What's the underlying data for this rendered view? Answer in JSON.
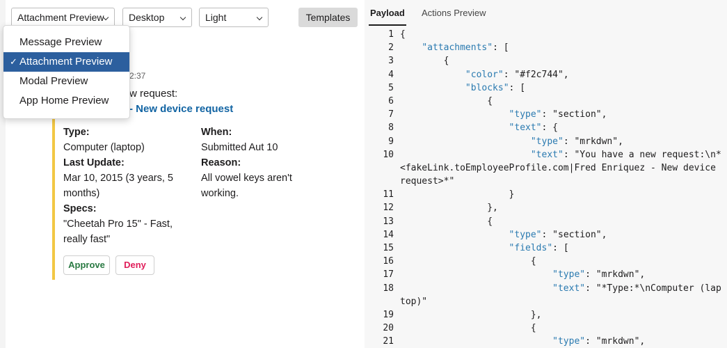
{
  "toolbar": {
    "view_select": "Attachment Preview",
    "device_select": "Desktop",
    "theme_select": "Light",
    "templates_label": "Templates"
  },
  "menu": {
    "items": [
      {
        "label": "Message Preview",
        "selected": false
      },
      {
        "label": "Attachment Preview",
        "selected": true
      },
      {
        "label": "Modal Preview",
        "selected": false
      },
      {
        "label": "App Home Preview",
        "selected": false
      }
    ],
    "check": "✓"
  },
  "message": {
    "time": "2:37",
    "text": "w request:",
    "link": "- New device request"
  },
  "attachment": {
    "color": "#f2c744",
    "fields": [
      {
        "title": "Type:",
        "value": "Computer (laptop)"
      },
      {
        "title": "When:",
        "value": "Submitted Aut 10"
      },
      {
        "title": "Last Update:",
        "value": "Mar 10, 2015 (3 years, 5 months)"
      },
      {
        "title": "Reason:",
        "value": "All vowel keys aren't working."
      },
      {
        "title": "Specs:",
        "value": "\"Cheetah Pro 15\" - Fast, really fast\""
      }
    ],
    "approve_label": "Approve",
    "deny_label": "Deny"
  },
  "tabs": {
    "payload": "Payload",
    "actions": "Actions Preview"
  },
  "code": {
    "lines": [
      {
        "n": "1",
        "pre": "{",
        "key": "",
        "post": ""
      },
      {
        "n": "2",
        "pre": "    ",
        "key": "\"attachments\"",
        "post": ": ["
      },
      {
        "n": "3",
        "pre": "        {",
        "key": "",
        "post": ""
      },
      {
        "n": "4",
        "pre": "            ",
        "key": "\"color\"",
        "post": ": \"#f2c744\","
      },
      {
        "n": "5",
        "pre": "            ",
        "key": "\"blocks\"",
        "post": ": ["
      },
      {
        "n": "6",
        "pre": "                {",
        "key": "",
        "post": ""
      },
      {
        "n": "7",
        "pre": "                    ",
        "key": "\"type\"",
        "post": ": \"section\","
      },
      {
        "n": "8",
        "pre": "                    ",
        "key": "\"text\"",
        "post": ": {"
      },
      {
        "n": "9",
        "pre": "                        ",
        "key": "\"type\"",
        "post": ": \"mrkdwn\","
      },
      {
        "n": "10",
        "pre": "                        ",
        "key": "\"text\"",
        "post": ": \"You have a new request:\\n*<fakeLink.toEmployeeProfile.com|Fred Enriquez - New device request>*\""
      },
      {
        "n": "11",
        "pre": "                    }",
        "key": "",
        "post": ""
      },
      {
        "n": "12",
        "pre": "                },",
        "key": "",
        "post": ""
      },
      {
        "n": "13",
        "pre": "                {",
        "key": "",
        "post": ""
      },
      {
        "n": "14",
        "pre": "                    ",
        "key": "\"type\"",
        "post": ": \"section\","
      },
      {
        "n": "15",
        "pre": "                    ",
        "key": "\"fields\"",
        "post": ": ["
      },
      {
        "n": "16",
        "pre": "                        {",
        "key": "",
        "post": ""
      },
      {
        "n": "17",
        "pre": "                            ",
        "key": "\"type\"",
        "post": ": \"mrkdwn\","
      },
      {
        "n": "18",
        "pre": "                            ",
        "key": "\"text\"",
        "post": ": \"*Type:*\\nComputer (laptop)\""
      },
      {
        "n": "19",
        "pre": "                        },",
        "key": "",
        "post": ""
      },
      {
        "n": "20",
        "pre": "                        {",
        "key": "",
        "post": ""
      },
      {
        "n": "21",
        "pre": "                            ",
        "key": "\"type\"",
        "post": ": \"mrkdwn\","
      }
    ]
  }
}
